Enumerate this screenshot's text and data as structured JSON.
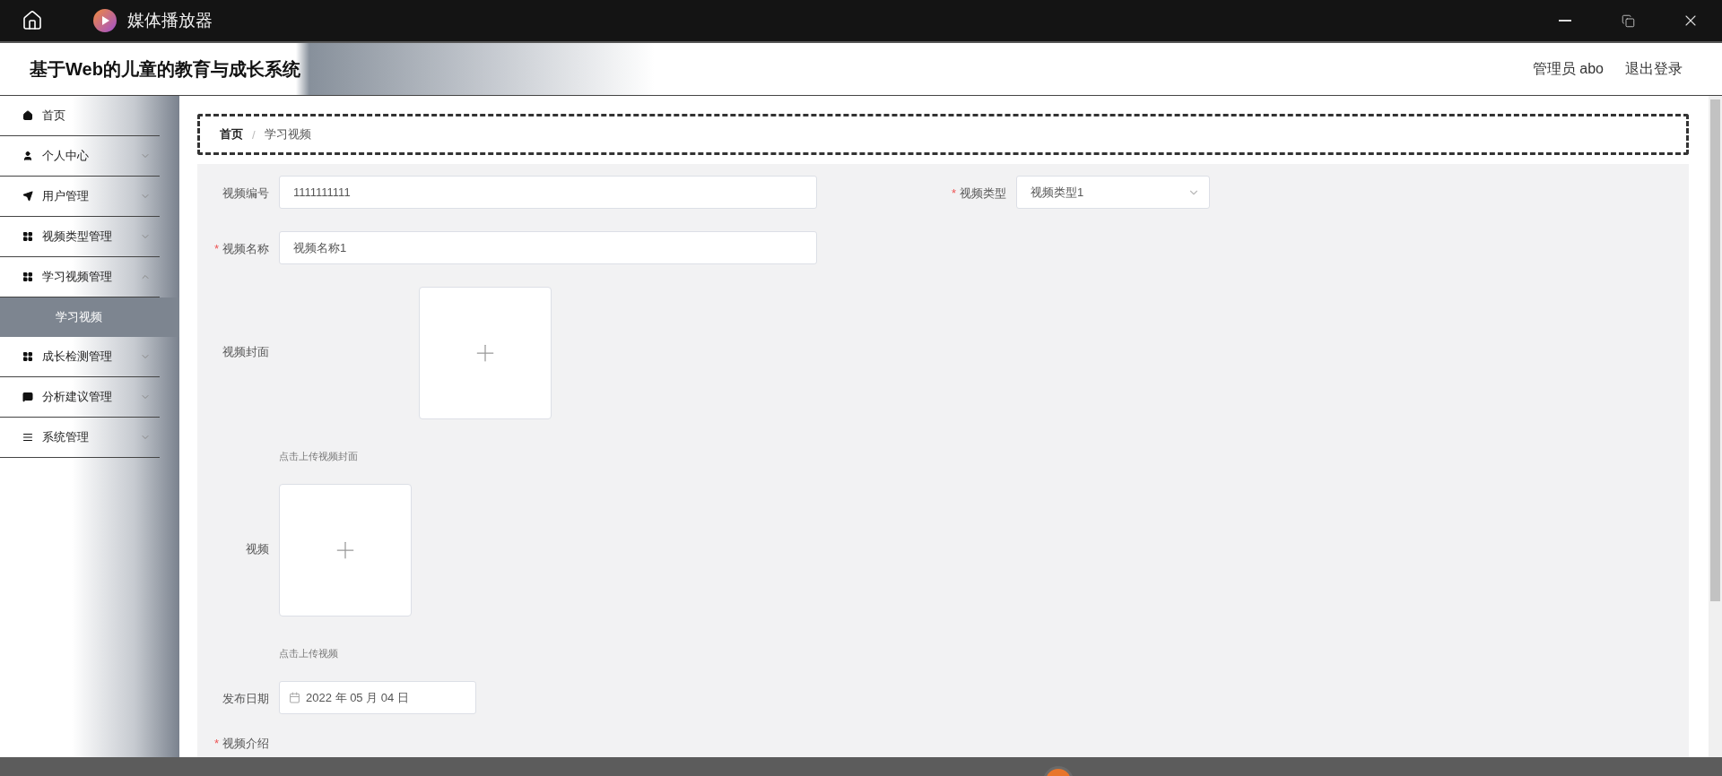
{
  "window": {
    "title": "媒体播放器"
  },
  "header": {
    "title": "基于Web的儿童的教育与成长系统",
    "user": "管理员 abo",
    "logout": "退出登录"
  },
  "sidebar": {
    "items": [
      {
        "label": "首页",
        "kind": "link"
      },
      {
        "label": "个人中心",
        "kind": "group",
        "expanded": false
      },
      {
        "label": "用户管理",
        "kind": "group",
        "expanded": false
      },
      {
        "label": "视频类型管理",
        "kind": "group",
        "expanded": false
      },
      {
        "label": "学习视频管理",
        "kind": "group",
        "expanded": true,
        "children": [
          {
            "label": "学习视频",
            "selected": true
          }
        ]
      },
      {
        "label": "成长检测管理",
        "kind": "group",
        "expanded": false
      },
      {
        "label": "分析建议管理",
        "kind": "group",
        "expanded": false
      },
      {
        "label": "系统管理",
        "kind": "group",
        "expanded": false
      }
    ]
  },
  "breadcrumb": {
    "items": [
      "首页",
      "学习视频"
    ],
    "separator": "/"
  },
  "form": {
    "rows": [
      [
        {
          "kind": "input",
          "label": "视频编号",
          "value": "1111111111"
        },
        {
          "kind": "select",
          "label": "视频类型",
          "mark": "*",
          "value": "视频类型1"
        }
      ],
      [
        {
          "kind": "input",
          "label": "视频名称",
          "mark": "*",
          "value": "视频名称1"
        }
      ],
      [
        {
          "kind": "image-upload",
          "label": "视频封面",
          "hint": "点击上传视频封面"
        }
      ],
      [
        {
          "kind": "video-upload",
          "label": "视频",
          "hint": "点击上传视频"
        }
      ],
      [
        {
          "kind": "date",
          "label": "发布日期",
          "value": "2022 年 05 月 04 日"
        }
      ],
      [
        {
          "kind": "textarea",
          "label": "视频介绍",
          "mark": "*"
        }
      ]
    ]
  }
}
